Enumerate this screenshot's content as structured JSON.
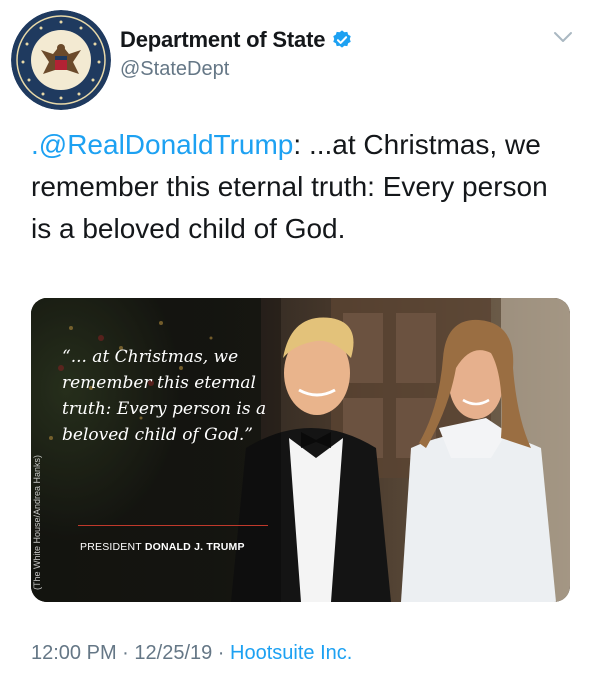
{
  "header": {
    "display_name": "Department of State",
    "handle": "@StateDept",
    "avatar_icon": "department-of-state-seal-icon",
    "seal_text": "DEPARTMENT OF STATE · UNITED STATES OF AMERICA",
    "verified_icon": "verified-badge-icon",
    "menu_icon": "chevron-down-icon"
  },
  "tweet": {
    "mention": ".@RealDonaldTrump",
    "text": ": ...at Christmas, we remember this eternal truth: Every person is a beloved child of God."
  },
  "media": {
    "quote": "“... at Christmas, we remember this eternal truth: Every person is a beloved child of God.”",
    "attribution_prefix": "PRESIDENT",
    "attribution_name": "DONALD J. TRUMP",
    "photo_credit": "(The White House/Andrea Hanks)"
  },
  "footer": {
    "time": "12:00 PM",
    "separator": " · ",
    "date": "12/25/19",
    "source": "Hootsuite Inc."
  },
  "colors": {
    "link": "#1da1f2",
    "secondary_text": "#657786",
    "primary_text": "#14171a"
  }
}
